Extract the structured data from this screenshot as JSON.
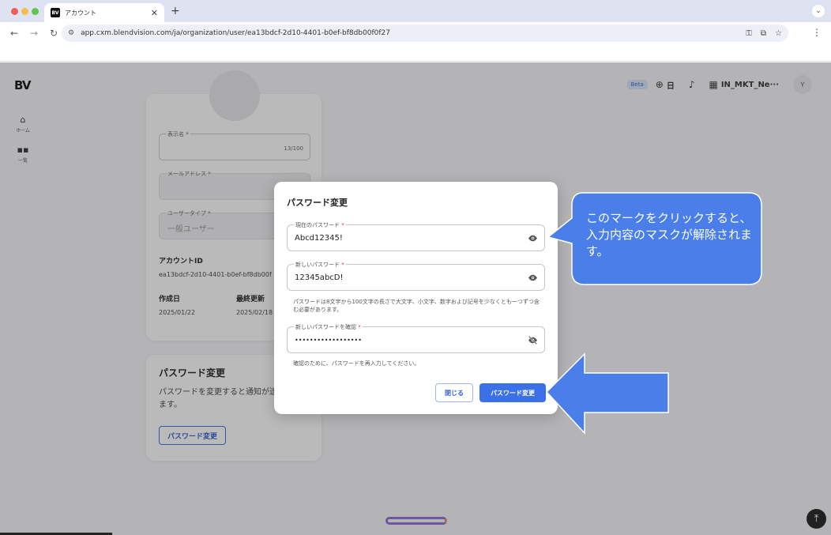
{
  "browser": {
    "tab_title": "アカウント",
    "favicon_text": "BV",
    "url": "app.cxm.blendvision.com/ja/organization/user/ea13bdcf-2d10-4401-b0ef-bf8db00f0f27"
  },
  "app": {
    "logo": "BV",
    "sidebar": [
      {
        "label": "ホーム",
        "icon": "home-icon"
      },
      {
        "label": "一覧",
        "icon": "grid-icon"
      }
    ],
    "header": {
      "beta": "Beta",
      "language": "日",
      "org_name": "IN_MKT_Ne···",
      "avatar": "Y"
    }
  },
  "profile": {
    "display_name": {
      "label": "表示名 *",
      "counter": "13/100"
    },
    "email": {
      "label": "メールアドレス *"
    },
    "user_type": {
      "label": "ユーザータイプ *",
      "value": "一般ユーザー"
    },
    "account_id_label": "アカウントID",
    "account_id": "ea13bdcf-2d10-4401-b0ef-bf8db00f",
    "created_label": "作成日",
    "created": "2025/01/22",
    "updated_label": "最終更新",
    "updated": "2025/02/18"
  },
  "password_card": {
    "title": "パスワード変更",
    "desc": "パスワードを変更すると通知が送られます。",
    "button": "パスワード変更"
  },
  "modal": {
    "title": "パスワード変更",
    "current": {
      "label": "現在のパスワード",
      "value": "Abcd12345!"
    },
    "new": {
      "label": "新しいパスワード",
      "value": "12345abcD!"
    },
    "new_helper": "パスワードは8文字から100文字の長さで大文字、小文字、数字および記号を少なくとも一つずつ含む必要があります。",
    "confirm": {
      "label": "新しいパスワードを確認",
      "value": "••••••••••••••••••"
    },
    "confirm_helper": "確認のために、パスワードを再入力してください。",
    "close_button": "閉じる",
    "submit_button": "パスワード変更",
    "required_mark": "*"
  },
  "annotation": {
    "callout": "このマークをクリックすると、入力内容のマスクが解除されます。",
    "color": "#4a7ee8"
  }
}
